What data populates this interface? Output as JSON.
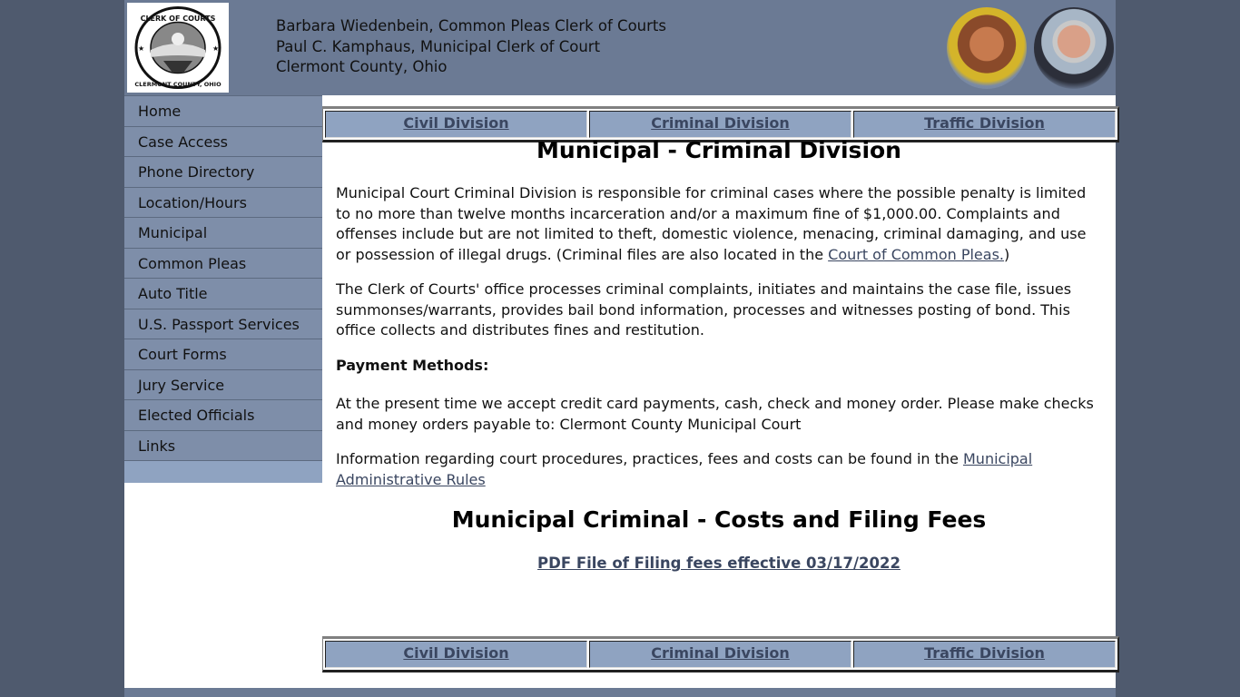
{
  "header": {
    "logo_alt": "Clerk of Courts Clermont County, Ohio seal",
    "logo_text_top": "CLERK OF COURTS",
    "logo_text_bottom": "CLERMONT COUNTY, OHIO",
    "lines": [
      "Barbara Wiedenbein, Common Pleas Clerk of Courts",
      "Paul C. Kamphaus, Municipal Clerk of Court",
      "Clermont County, Ohio"
    ],
    "portraits": [
      "Barbara Wiedenbein",
      "Paul C. Kamphaus"
    ]
  },
  "sidebar": {
    "items": [
      {
        "label": "Home"
      },
      {
        "label": "Case Access"
      },
      {
        "label": "Phone Directory"
      },
      {
        "label": "Location/Hours"
      },
      {
        "label": "Municipal"
      },
      {
        "label": "Common Pleas"
      },
      {
        "label": "Auto Title"
      },
      {
        "label": "U.S. Passport Services"
      },
      {
        "label": "Court Forms"
      },
      {
        "label": "Jury Service"
      },
      {
        "label": "Elected Officials"
      },
      {
        "label": "Links"
      }
    ]
  },
  "division_nav": {
    "civil": "Civil Division",
    "criminal": "Criminal Division",
    "traffic": "Traffic Division"
  },
  "main": {
    "title": "Municipal - Criminal Division",
    "p1_text": "Municipal Court Criminal Division is responsible for criminal cases where the possible penalty is limited to no more than twelve months incarceration and/or a maximum fine of $1,000.00. Complaints and offenses include but are not limited to theft, domestic violence, menacing, criminal damaging, and use or possession of illegal drugs. (Criminal files are also located in the ",
    "p1_link": "Court of Common Pleas.",
    "p1_tail": ")",
    "p2": "The Clerk of Courts' office processes criminal complaints, initiates and maintains the case file, issues summonses/warrants, provides bail bond information, processes and witnesses posting of bond. This office collects and distributes fines and restitution.",
    "payment_heading": "Payment Methods:",
    "p3": "At the present time we accept credit card payments, cash, check and money order. Please make checks and money orders payable to: Clermont County Municipal Court",
    "p4_text": "Information regarding court procedures, practices, fees and costs can be found in the ",
    "p4_link": "Municipal Administrative Rules",
    "fees_title": "Municipal Criminal - Costs and Filing Fees",
    "pdf_link": "PDF File of Filing fees effective 03/17/2022"
  },
  "colors": {
    "header_bg": "#6b7a94",
    "nav_bg": "#7e8ea9",
    "division_bg": "#8fa3c1",
    "link": "#3a4660",
    "outer_bg": "#4f5a6e"
  }
}
